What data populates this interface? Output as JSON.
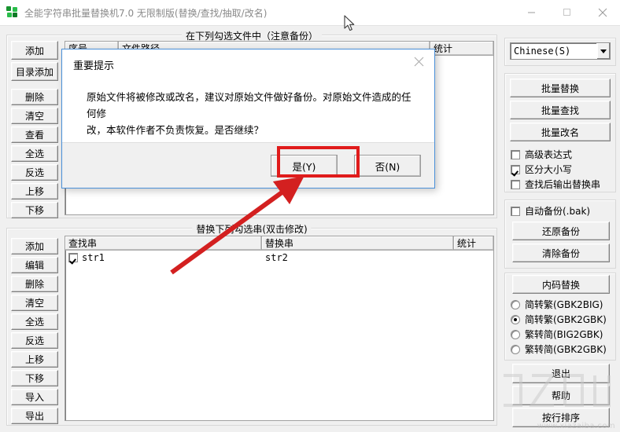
{
  "window": {
    "title": "全能字符串批量替换机7.0 无限制版(替换/查找/抽取/改名)",
    "icon": "app-logo-icon",
    "minimize": "—",
    "maximize": "□",
    "close": "✕"
  },
  "top_panel": {
    "group_label": "在下列勾选文件中（注意备份）",
    "columns": [
      "序号",
      "文件路径",
      "统计"
    ],
    "rows": [],
    "buttons": [
      "添加",
      "目录添加",
      "删除",
      "清空",
      "查看",
      "全选",
      "反选",
      "上移",
      "下移"
    ]
  },
  "bottom_panel": {
    "group_label": "替换下列勾选串(双击修改)",
    "columns": [
      "查找串",
      "替换串",
      "统计"
    ],
    "rows": [
      {
        "checked": true,
        "find": "str1",
        "replace": "str2",
        "count": ""
      }
    ],
    "buttons": [
      "添加",
      "编辑",
      "删除",
      "清空",
      "全选",
      "反选",
      "上移",
      "下移",
      "导入",
      "导出"
    ]
  },
  "right_panel": {
    "encoding": {
      "value": "Chinese(S)",
      "arrow_icon": "chevron-down-icon"
    },
    "actions": [
      "批量替换",
      "批量查找",
      "批量改名"
    ],
    "options": [
      {
        "label": "高级表达式",
        "checked": false
      },
      {
        "label": "区分大小写",
        "checked": true
      },
      {
        "label": "查找后输出替换串",
        "checked": false
      }
    ],
    "backup": {
      "auto_label": "自动备份(.bak)",
      "auto_checked": false,
      "restore": "还原备份",
      "clear": "清除备份"
    },
    "encoding_convert": {
      "button": "内码替换",
      "radios": [
        {
          "label": "简转繁(GBK2BIG)",
          "selected": false
        },
        {
          "label": "简转繁(GBK2GBK)",
          "selected": true
        },
        {
          "label": "繁转简(BIG2GBK)",
          "selected": false
        },
        {
          "label": "繁转简(GBK2GBK)",
          "selected": false
        }
      ]
    },
    "footer_buttons": [
      "退出",
      "帮助",
      "按行排序"
    ]
  },
  "dialog": {
    "title": "重要提示",
    "close_icon": "close-icon",
    "message_line1": "原始文件将被修改或改名，建议对原始文件做好备份。对原始文件造成的任何修",
    "message_line2": "改，本软件作者不负责恢复。是否继续？",
    "yes_button": "是(Y)",
    "no_button": "否(N)"
  },
  "annotations": {
    "highlight_target": "yes-button",
    "arrow": "red-arrow-pointing-to-yes-button",
    "highlight_color": "#e01b1b"
  },
  "watermark": {
    "text": "www.xiazaiba.com"
  }
}
